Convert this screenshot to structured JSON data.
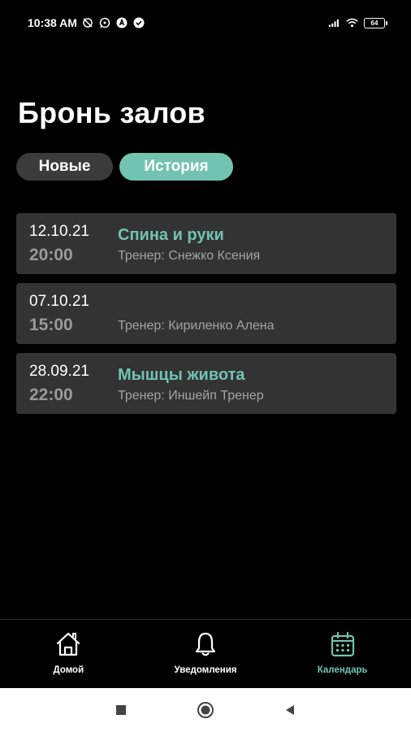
{
  "status_bar": {
    "time": "10:38 AM",
    "battery": "64"
  },
  "page": {
    "title": "Бронь залов"
  },
  "tabs": [
    {
      "label": "Новые",
      "active": false
    },
    {
      "label": "История",
      "active": true
    }
  ],
  "bookings": [
    {
      "date": "12.10.21",
      "time": "20:00",
      "title": "Спина и руки",
      "trainer": "Тренер: Снежко Ксения"
    },
    {
      "date": "07.10.21",
      "time": "15:00",
      "title": "",
      "trainer": "Тренер: Кириленко  Алена"
    },
    {
      "date": "28.09.21",
      "time": "22:00",
      "title": "Мышцы живота",
      "trainer": "Тренер: Иншейп Тренер"
    }
  ],
  "bottom_nav": [
    {
      "label": "Домой",
      "icon": "home-icon",
      "active": false
    },
    {
      "label": "Уведомления",
      "icon": "bell-icon",
      "active": false
    },
    {
      "label": "Календарь",
      "icon": "calendar-icon",
      "active": true
    }
  ],
  "colors": {
    "accent": "#72c3b0",
    "background": "#000000",
    "card": "#333333",
    "tab_inactive": "#3b3b3b",
    "muted_text": "#a3a3a3"
  }
}
